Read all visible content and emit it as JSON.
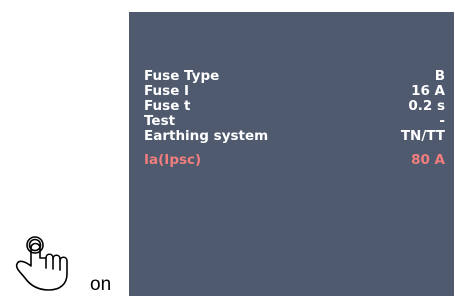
{
  "caption": "on",
  "hand_icon": "tap-hand-icon",
  "colors": {
    "panel_background": "#4f5a6e",
    "text": "#ffffff",
    "highlight": "#f07e7e"
  },
  "settings": [
    {
      "label": "Fuse Type",
      "value": "B"
    },
    {
      "label": "Fuse I",
      "value": "16 A"
    },
    {
      "label": "Fuse t",
      "value": "0.2 s"
    },
    {
      "label": "Test",
      "value": "-"
    },
    {
      "label": "Earthing system",
      "value": "TN/TT"
    }
  ],
  "result": {
    "label": "Ia(Ipsc)",
    "value": "80 A"
  }
}
